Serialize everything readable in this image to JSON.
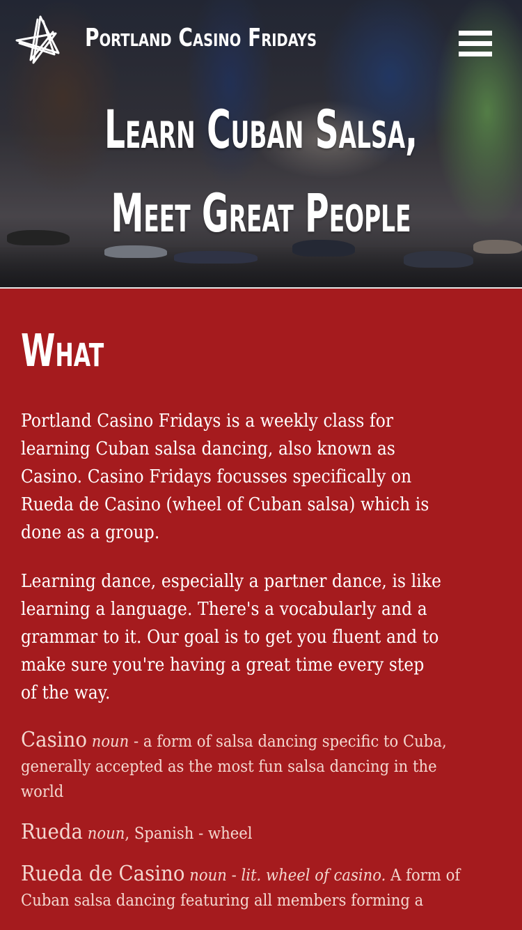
{
  "header": {
    "site_title": "Portland Casino Fridays",
    "menu_icon": "hamburger-menu-icon",
    "logo_icon": "star-logo-icon"
  },
  "hero": {
    "heading_line1": "Learn Cuban Salsa,",
    "heading_line2": "Meet Great People"
  },
  "section": {
    "title": "What",
    "paragraph1": [
      "Portland Casino Fridays is a weekly class for",
      "learning Cuban salsa dancing, also known as",
      "Casino. Casino Fridays focusses specifically on",
      "Rueda de Casino (wheel of Cuban salsa) which is",
      "done as a group."
    ],
    "paragraph2": [
      "Learning dance, especially a partner dance, is like",
      "learning a language. There's a vocabularly and a",
      "grammar to it. Our goal is to get you fluent and to",
      "make sure you're having a great time every step",
      "of the way."
    ],
    "definitions": [
      {
        "term": "Casino",
        "pos": "noun",
        "rest_line1": " - a form of salsa dancing specific to Cuba,",
        "line2": "generally accepted as the most fun salsa dancing in the",
        "line3": "world"
      },
      {
        "term": "Rueda",
        "pos": "noun",
        "rest": ", Spanish - wheel"
      },
      {
        "term": "Rueda de Casino",
        "pos": "noun",
        "sep": " - ",
        "lit": "lit. wheel of casino.",
        "rest_line1": " A form of",
        "line2": "Cuban salsa dancing featuring all members forming a"
      }
    ]
  },
  "colors": {
    "page_background": "#a51b1e",
    "definition_text": "#f3d7cf",
    "text": "#ffffff"
  }
}
